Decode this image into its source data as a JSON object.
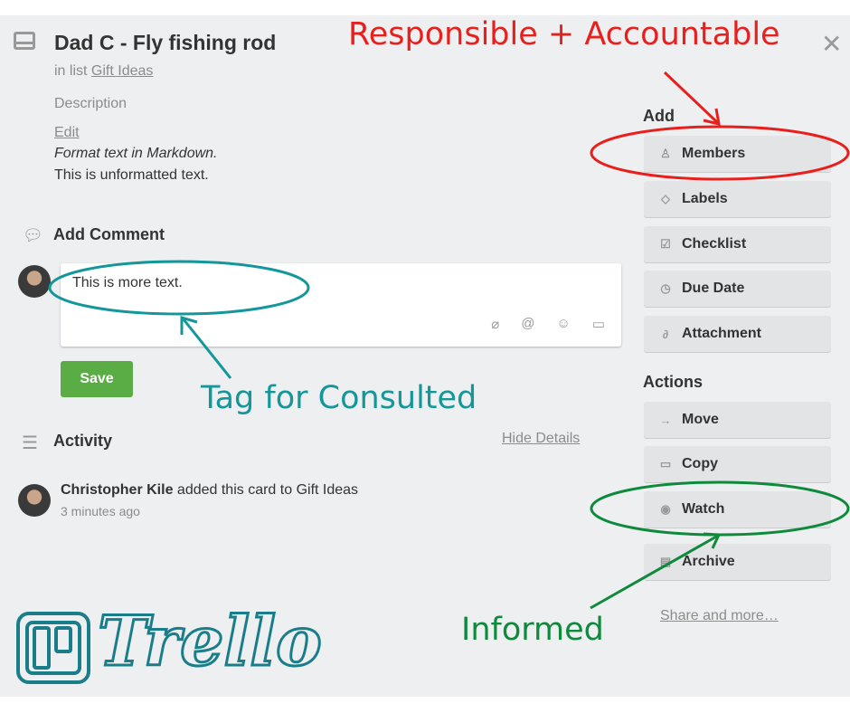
{
  "card": {
    "title": "Dad C - Fly fishing rod",
    "in_list_prefix": "in list",
    "list_name": "Gift Ideas",
    "description_label": "Description",
    "edit_link": "Edit",
    "desc_italic": "Format text in Markdown.",
    "desc_plain": "This is unformatted text."
  },
  "comment": {
    "heading": "Add Comment",
    "value": "This is more text.",
    "save_label": "Save"
  },
  "activity": {
    "heading": "Activity",
    "hide_details": "Hide Details",
    "entries": [
      {
        "user": "Christopher Kile",
        "action": "added this card to Gift Ideas",
        "time": "3 minutes ago"
      }
    ]
  },
  "sidebar": {
    "add_heading": "Add",
    "add_items": [
      {
        "label": "Members",
        "icon": "person-icon"
      },
      {
        "label": "Labels",
        "icon": "tag-icon"
      },
      {
        "label": "Checklist",
        "icon": "checkbox-icon"
      },
      {
        "label": "Due Date",
        "icon": "clock-icon"
      },
      {
        "label": "Attachment",
        "icon": "paperclip-icon"
      }
    ],
    "actions_heading": "Actions",
    "action_items": [
      {
        "label": "Move",
        "icon": "arrow-right-icon"
      },
      {
        "label": "Copy",
        "icon": "card-icon"
      },
      {
        "label": "Watch",
        "icon": "eye-icon"
      },
      {
        "label": "Archive",
        "icon": "archive-icon"
      }
    ],
    "share_link": "Share and more…"
  },
  "annotations": {
    "responsible": "Responsible + Accountable",
    "consulted": "Tag for Consulted",
    "informed": "Informed",
    "colors": {
      "red": "#e8201d",
      "teal": "#14979a",
      "green": "#0f8a3c"
    }
  },
  "logo": {
    "text": "Trello"
  }
}
